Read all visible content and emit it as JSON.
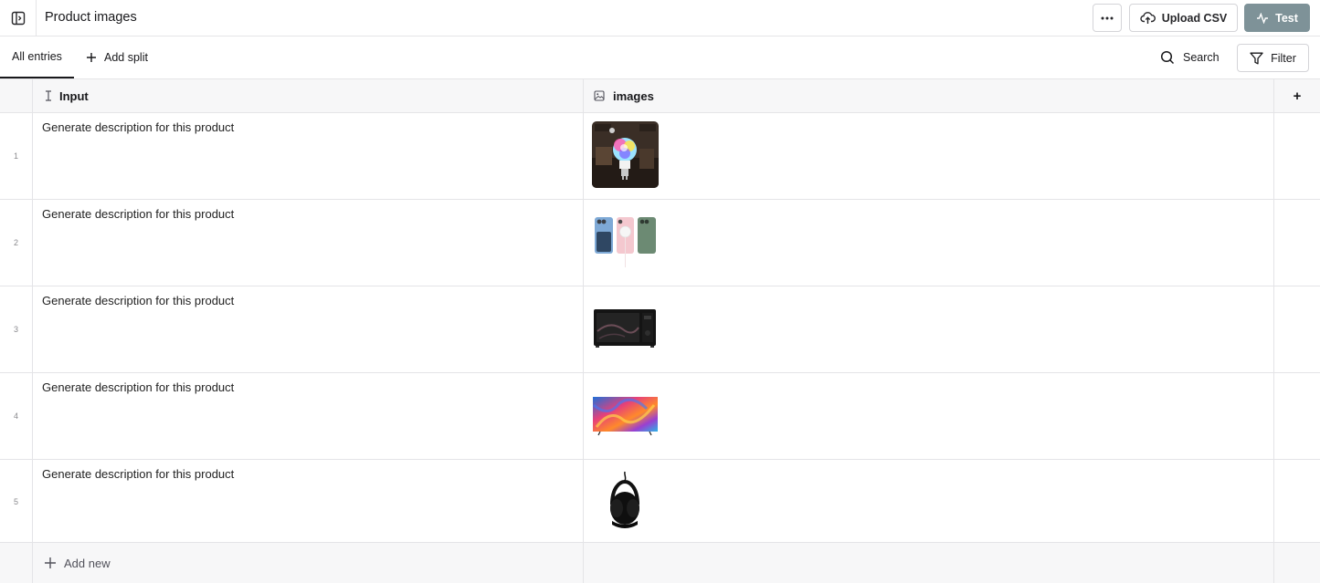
{
  "header": {
    "title": "Product images",
    "sidebar_toggle_icon": "sidebar-toggle-icon",
    "more_icon": "more-horizontal-icon",
    "upload_label": "Upload CSV",
    "upload_icon": "cloud-upload-icon",
    "test_label": "Test",
    "test_icon": "activity-icon"
  },
  "tabs": {
    "all_entries": "All entries",
    "add_split": "Add split"
  },
  "toolbar": {
    "search_label": "Search",
    "filter_label": "Filter"
  },
  "table": {
    "columns": [
      {
        "label": "Input",
        "icon": "text-cursor-icon"
      },
      {
        "label": "images",
        "icon": "image-icon"
      }
    ],
    "add_column_label": "+",
    "rows": [
      {
        "index": "1",
        "input": "Generate description for this product",
        "image": "smart-bulb"
      },
      {
        "index": "2",
        "input": "Generate description for this product",
        "image": "phones"
      },
      {
        "index": "3",
        "input": "Generate description for this product",
        "image": "microwave"
      },
      {
        "index": "4",
        "input": "Generate description for this product",
        "image": "tv"
      },
      {
        "index": "5",
        "input": "Generate description for this product",
        "image": "headphones"
      }
    ],
    "add_new_label": "Add new"
  },
  "colors": {
    "test_button_bg": "#7e9298",
    "border": "#e4e4e7",
    "header_bg": "#f7f7f8"
  }
}
